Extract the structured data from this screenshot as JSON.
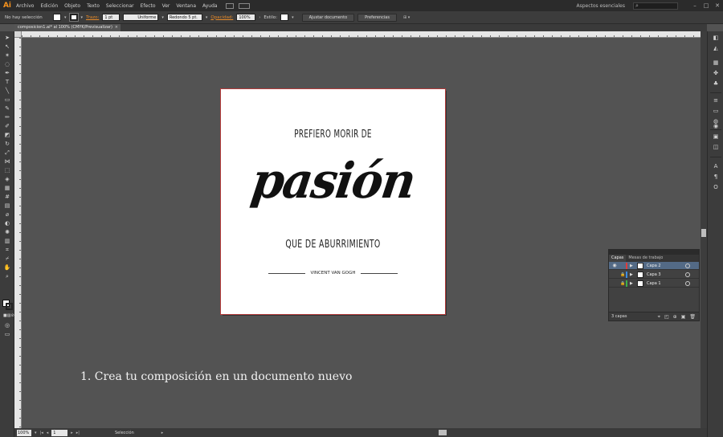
{
  "app": {
    "logo": "Ai",
    "menu": [
      "Archivo",
      "Edición",
      "Objeto",
      "Texto",
      "Seleccionar",
      "Efecto",
      "Ver",
      "Ventana",
      "Ayuda"
    ],
    "workspace": "Aspectos esenciales",
    "window_controls": [
      "–",
      "□",
      "✕"
    ]
  },
  "controlbar": {
    "selection_label": "No hay selección",
    "stroke_label": "Trazo:",
    "stroke_weight": "1 pt",
    "stroke_profile": "Uniforme",
    "brush": "Redondo 5 pt.",
    "opacity_label": "Opacidad:",
    "opacity_value": "100%",
    "style_label": "Estilo:",
    "doc_setup_button": "Ajustar documento",
    "prefs_button": "Preferencias"
  },
  "document": {
    "tab_title": "composicion1.ai* al 100% (CMYK/Previsualizar)",
    "tab_close": "×"
  },
  "artboard": {
    "line1": "PREFIERO MORIR DE",
    "big_word": "pasión",
    "line2": "QUE DE ABURRIMIENTO",
    "author": "VINCENT VAN GOGH"
  },
  "caption": "1. Crea tu composición en un documento nuevo",
  "statusbar": {
    "zoom": "100%",
    "page": "1",
    "tool_name": "Selección"
  },
  "layers_panel": {
    "tabs": [
      "Capas",
      "Mesas de trabajo"
    ],
    "layers": [
      {
        "name": "Capa 2",
        "color": "#e03c3c",
        "selected": true
      },
      {
        "name": "Capa 3",
        "color": "#3c8be0",
        "selected": false
      },
      {
        "name": "Capa 1",
        "color": "#3cb04a",
        "selected": false
      }
    ],
    "footer": "3 capas"
  },
  "colors": {
    "artboard_outline": "#b33a3a",
    "selected_layer": "#536a86",
    "app_accent": "#f7931e"
  }
}
